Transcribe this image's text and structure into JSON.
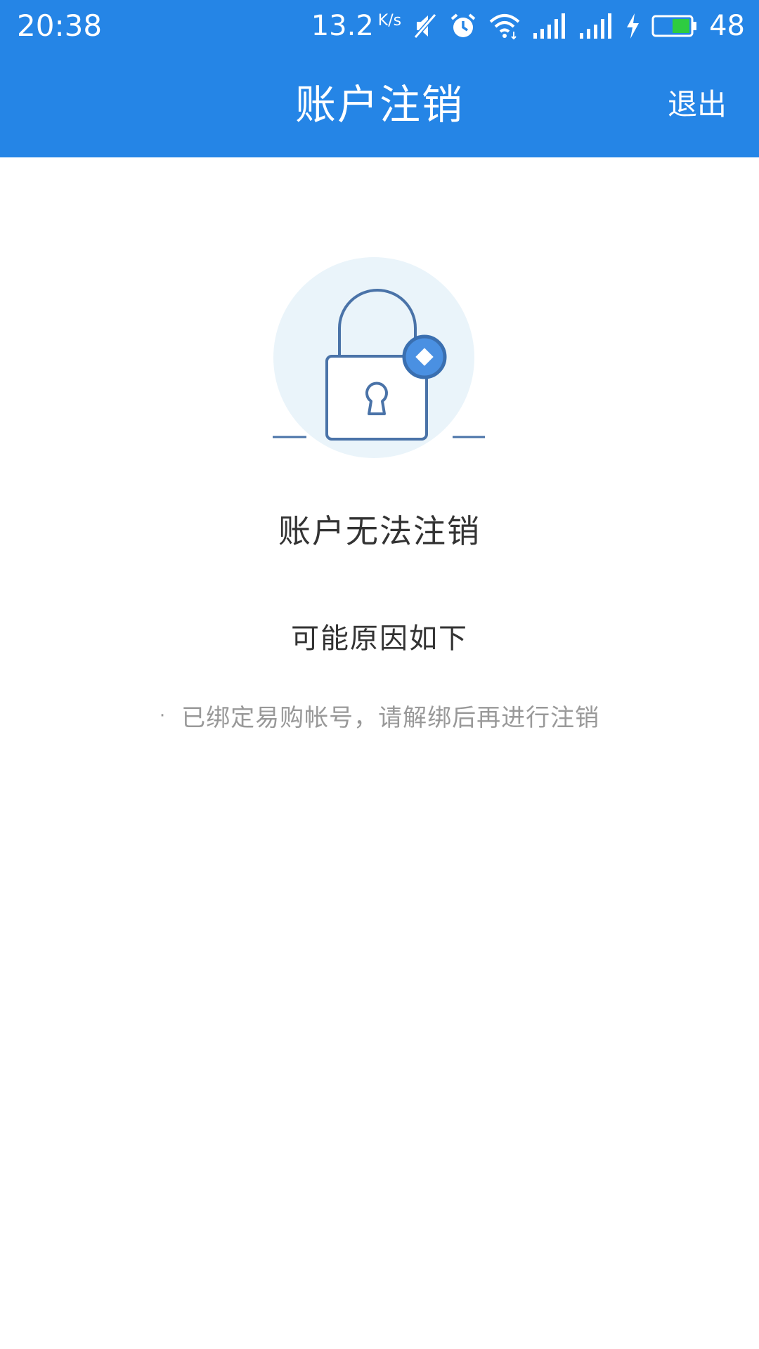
{
  "status_bar": {
    "time": "20:38",
    "net_speed": "13.2",
    "net_speed_unit": "K/s",
    "battery": "48"
  },
  "header": {
    "title": "账户注销",
    "exit_label": "退出"
  },
  "main": {
    "heading": "账户无法注销",
    "subheading": "可能原因如下",
    "reasons": [
      {
        "bullet": "·",
        "text": "已绑定易购帐号，请解绑后再进行注销"
      }
    ]
  },
  "colors": {
    "brand": "#2585e6",
    "lock_stroke": "#4a73a8",
    "lock_badge": "#4a90e2",
    "circle_bg": "#eaf4fa"
  }
}
